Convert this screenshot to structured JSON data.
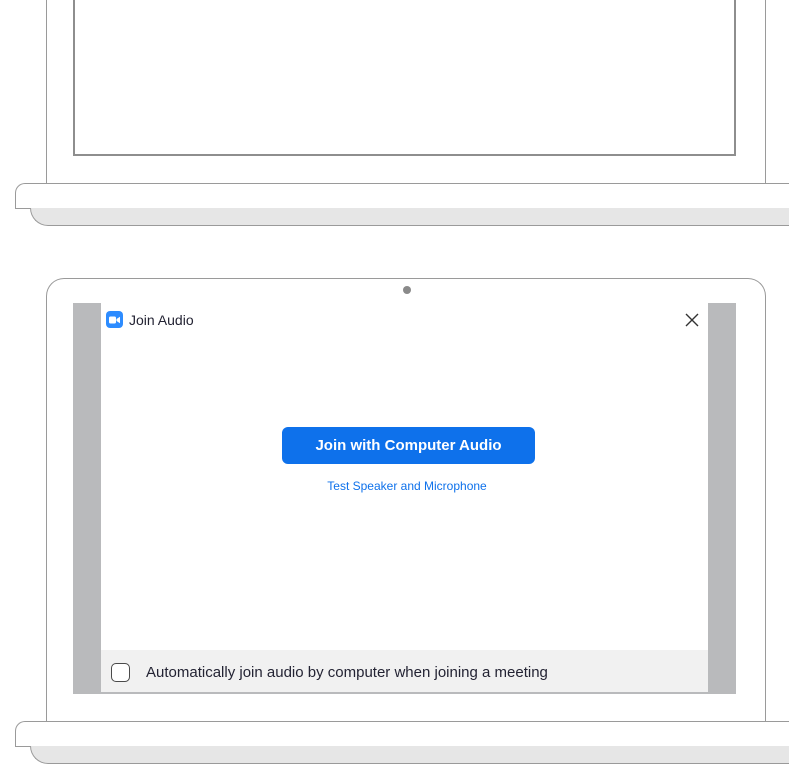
{
  "dialog": {
    "title": "Join Audio",
    "app_icon": "video-camera-icon",
    "close_icon": "close-icon",
    "join_button_label": "Join with Computer Audio",
    "test_link_label": "Test Speaker and Microphone",
    "auto_join": {
      "label": "Automatically join audio by computer when joining a meeting",
      "checked": false
    }
  },
  "colors": {
    "accent": "#0e71eb",
    "app_icon_bg": "#2d8cff",
    "screen_bezel": "#b9babc",
    "footer_bg": "#f1f1f1"
  }
}
